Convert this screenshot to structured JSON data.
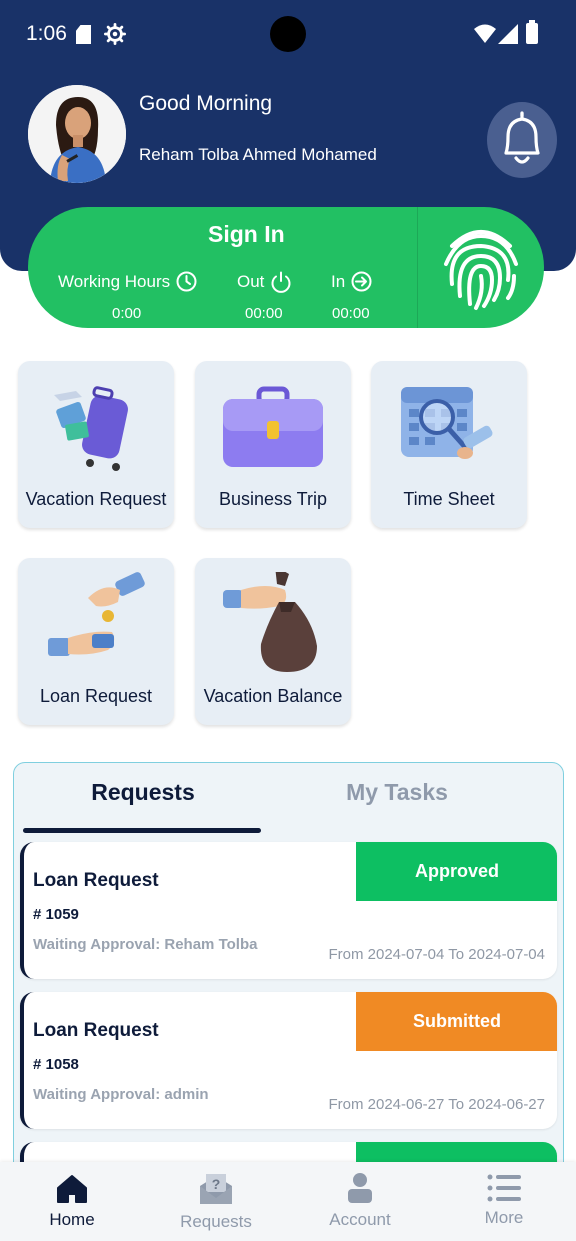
{
  "status_bar": {
    "time": "1:06"
  },
  "header": {
    "greeting": "Good Morning",
    "user_name": "Reham Tolba Ahmed Mohamed"
  },
  "attendance": {
    "title": "Sign In",
    "working_hours_label": "Working Hours",
    "working_hours_value": "0:00",
    "out_label": "Out",
    "out_value": "00:00",
    "in_label": "In",
    "in_value": "00:00"
  },
  "services": [
    {
      "label": "Vacation Request",
      "icon": "suitcase-icon"
    },
    {
      "label": "Business Trip",
      "icon": "briefcase-icon"
    },
    {
      "label": "Time Sheet",
      "icon": "calendar-icon"
    },
    {
      "label": "Loan Request",
      "icon": "coin-handover-icon"
    },
    {
      "label": "Vacation Balance",
      "icon": "money-bag-icon"
    }
  ],
  "tabs": {
    "requests": "Requests",
    "my_tasks": "My Tasks",
    "active": "Requests"
  },
  "requests": [
    {
      "title": "Loan Request",
      "number": "# 1059",
      "waiting": "Waiting Approval: Reham Tolba",
      "dates": "From 2024-07-04 To 2024-07-04",
      "status": "Approved",
      "status_color": "#0dbf62"
    },
    {
      "title": "Loan Request",
      "number": "# 1058",
      "waiting": "Waiting Approval: admin",
      "dates": "From 2024-06-27 To 2024-06-27",
      "status": "Submitted",
      "status_color": "#f08a24"
    },
    {
      "status_color": "#0dbf62"
    }
  ],
  "bottom_nav": [
    {
      "label": "Home",
      "icon": "home-icon",
      "active": true
    },
    {
      "label": "Requests",
      "icon": "envelope-question-icon",
      "active": false
    },
    {
      "label": "Account",
      "icon": "person-icon",
      "active": false
    },
    {
      "label": "More",
      "icon": "menu-list-icon",
      "active": false
    }
  ],
  "colors": {
    "header_bg": "#193268",
    "signin_green": "#22c063",
    "navy_text": "#0e1b3a",
    "muted_text": "#8f9aab"
  }
}
